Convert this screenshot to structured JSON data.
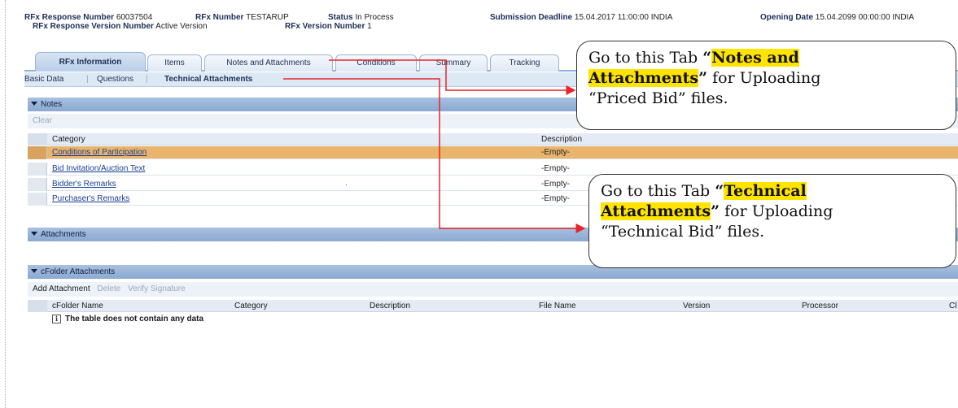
{
  "header": {
    "response_number_label": "RFx Response Number",
    "response_number": "60037504",
    "rfx_number_label": "RFx Number",
    "rfx_number": "TESTARUP",
    "status_label": "Status",
    "status": "In Process",
    "deadline_label": "Submission Deadline",
    "deadline": "15.04.2017 11:00:00 INDIA",
    "opening_label": "Opening Date",
    "opening": "15.04.2099 00:00:00 INDIA",
    "response_version_label": "RFx Response Version Number",
    "response_version": "Active Version",
    "rfx_version_label": "RFx Version Number",
    "rfx_version": "1"
  },
  "tabs": [
    {
      "label": "RFx Information",
      "active": true
    },
    {
      "label": "Items"
    },
    {
      "label": "Notes and Attachments"
    },
    {
      "label": "Conditions"
    },
    {
      "label": "Summary"
    },
    {
      "label": "Tracking"
    }
  ],
  "subnav": [
    "Basic Data",
    "Questions",
    "Technical Attachments"
  ],
  "notes": {
    "title": "Notes",
    "clear_label": "Clear",
    "col_category": "Category",
    "col_description": "Description",
    "rows": [
      {
        "category": "Conditions of Participation",
        "description": "-Empty-",
        "selected": true
      },
      {
        "category": "Bid Invitation/Auction Text",
        "description": "-Empty-"
      },
      {
        "category": "Bidder's Remarks",
        "description": "-Empty-"
      },
      {
        "category": "Purchaser's Remarks",
        "description": "-Empty-"
      }
    ]
  },
  "attachments": {
    "title": "Attachments"
  },
  "cfolder": {
    "title": "cFolder Attachments",
    "add_label": "Add Attachment",
    "delete_label": "Delete",
    "verify_label": "Verify Signature",
    "columns": [
      "cFolder Name",
      "Category",
      "Description",
      "File Name",
      "Version",
      "Processor",
      "Cl"
    ],
    "empty_text": "The table does not contain any data"
  },
  "callouts": {
    "notes": {
      "prefix": "Go to this Tab ",
      "open_q": "“",
      "highlight_1": "Notes and",
      "highlight_2": "Attachments",
      "close_q": "”",
      "suffix_1": " for Uploading",
      "suffix_2": "“Priced Bid” files."
    },
    "technical": {
      "prefix": "Go to this Tab ",
      "open_q": "“",
      "highlight_1": "Technical",
      "highlight_2": "Attachments",
      "close_q": "”",
      "suffix_1": " for Uploading",
      "suffix_2": "“Technical Bid” files."
    }
  },
  "colors": {
    "accent": "#8aa8d1",
    "selected_row": "#e9b46b",
    "highlight": "#ffe400",
    "arrow": "#e8242b"
  }
}
